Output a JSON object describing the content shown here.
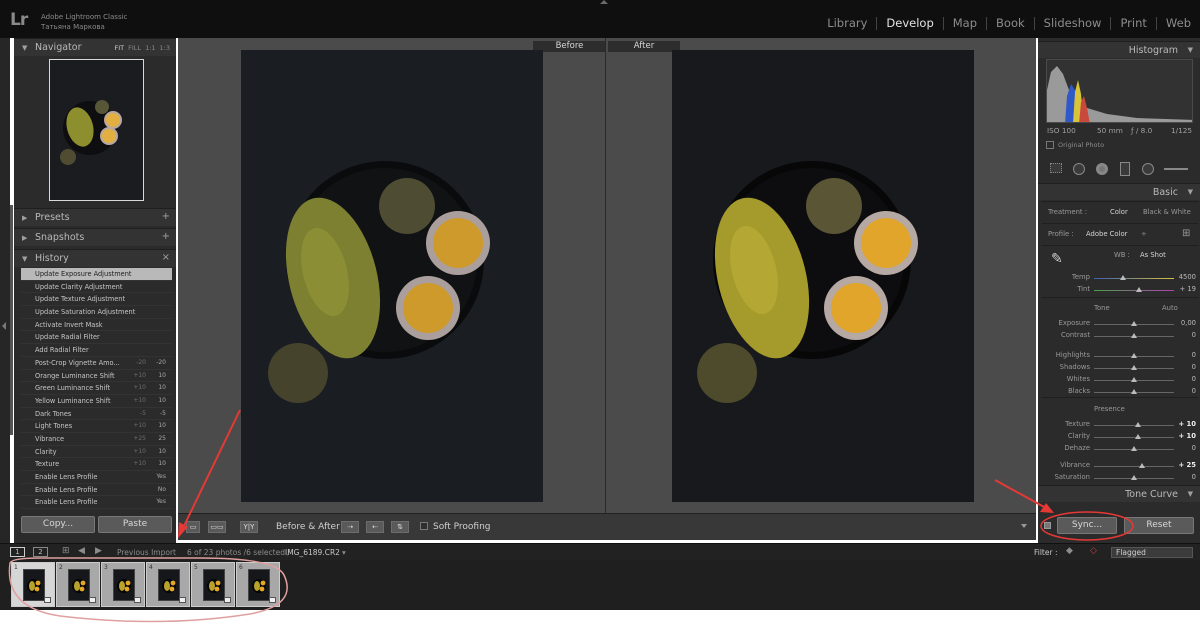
{
  "app": {
    "logo": "Lr",
    "name": "Adobe Lightroom Classic",
    "user": "Татьяна Маркова"
  },
  "modules": [
    {
      "label": "Library",
      "active": false
    },
    {
      "label": "Develop",
      "active": true
    },
    {
      "label": "Map",
      "active": false
    },
    {
      "label": "Book",
      "active": false
    },
    {
      "label": "Slideshow",
      "active": false
    },
    {
      "label": "Print",
      "active": false
    },
    {
      "label": "Web",
      "active": false
    }
  ],
  "left": {
    "navigator": {
      "title": "Navigator",
      "fit": "FIT",
      "fill": "FILL",
      "one": "1:1",
      "three": "1:3"
    },
    "presets": {
      "title": "Presets"
    },
    "snapshots": {
      "title": "Snapshots"
    },
    "history": {
      "title": "History",
      "items": [
        {
          "label": "Update Exposure Adjustment",
          "from": "",
          "to": ""
        },
        {
          "label": "Update Clarity Adjustment",
          "from": "",
          "to": ""
        },
        {
          "label": "Update Texture Adjustment",
          "from": "",
          "to": ""
        },
        {
          "label": "Update Saturation Adjustment",
          "from": "",
          "to": ""
        },
        {
          "label": "Activate Invert Mask",
          "from": "",
          "to": ""
        },
        {
          "label": "Update Radial Filter",
          "from": "",
          "to": ""
        },
        {
          "label": "Add Radial Filter",
          "from": "",
          "to": ""
        },
        {
          "label": "Post-Crop Vignette Amo...",
          "from": "-20",
          "to": "-20"
        },
        {
          "label": "Orange Luminance Shift",
          "from": "+10",
          "to": "10"
        },
        {
          "label": "Green Luminance Shift",
          "from": "+10",
          "to": "10"
        },
        {
          "label": "Yellow Luminance Shift",
          "from": "+10",
          "to": "10"
        },
        {
          "label": "Dark Tones",
          "from": "-5",
          "to": "-5"
        },
        {
          "label": "Light Tones",
          "from": "+10",
          "to": "10"
        },
        {
          "label": "Vibrance",
          "from": "+25",
          "to": "25"
        },
        {
          "label": "Clarity",
          "from": "+10",
          "to": "10"
        },
        {
          "label": "Texture",
          "from": "+10",
          "to": "10"
        },
        {
          "label": "Enable Lens Profile",
          "from": "",
          "to": "Yes"
        },
        {
          "label": "Enable Lens Profile",
          "from": "",
          "to": "No"
        },
        {
          "label": "Enable Lens Profile",
          "from": "",
          "to": "Yes"
        }
      ]
    },
    "copy_label": "Copy...",
    "paste_label": "Paste"
  },
  "center": {
    "before_label": "Before",
    "after_label": "After"
  },
  "toolbar": {
    "view_yy": "Y|Y",
    "before_after_label": "Before & After :",
    "soft_proofing_label": "Soft Proofing"
  },
  "right": {
    "histogram": {
      "title": "Histogram",
      "iso": "ISO 100",
      "focal": "50 mm",
      "aperture": "ƒ / 8.0",
      "shutter": "1/125",
      "original_photo": "Original Photo"
    },
    "basic": {
      "title": "Basic",
      "treatment_label": "Treatment :",
      "treatment_color": "Color",
      "treatment_bw": "Black & White",
      "profile_label": "Profile :",
      "profile_value": "Adobe Color",
      "wb_label": "WB :",
      "wb_value": "As Shot",
      "tone_label": "Tone",
      "auto_label": "Auto",
      "presence_label": "Presence",
      "sliders": [
        {
          "label": "Temp",
          "value": "4500",
          "pos": 0.36,
          "lit": false
        },
        {
          "label": "Tint",
          "value": "+ 19",
          "pos": 0.56,
          "lit": false
        },
        {
          "label": "Exposure",
          "value": "0,00",
          "pos": 0.5,
          "lit": false
        },
        {
          "label": "Contrast",
          "value": "0",
          "pos": 0.5,
          "lit": false
        },
        {
          "label": "Highlights",
          "value": "0",
          "pos": 0.5,
          "lit": false
        },
        {
          "label": "Shadows",
          "value": "0",
          "pos": 0.5,
          "lit": false
        },
        {
          "label": "Whites",
          "value": "0",
          "pos": 0.5,
          "lit": false
        },
        {
          "label": "Blacks",
          "value": "0",
          "pos": 0.5,
          "lit": false
        },
        {
          "label": "Texture",
          "value": "+ 10",
          "pos": 0.55,
          "lit": true
        },
        {
          "label": "Clarity",
          "value": "+ 10",
          "pos": 0.55,
          "lit": true
        },
        {
          "label": "Dehaze",
          "value": "0",
          "pos": 0.5,
          "lit": false
        },
        {
          "label": "Vibrance",
          "value": "+ 25",
          "pos": 0.6,
          "lit": true
        },
        {
          "label": "Saturation",
          "value": "0",
          "pos": 0.5,
          "lit": false
        }
      ]
    },
    "tone_curve": {
      "title": "Tone Curve"
    },
    "sync_label": "Sync...",
    "reset_label": "Reset"
  },
  "filmstrip": {
    "screen1": "1",
    "screen2": "2",
    "source": "Previous Import",
    "count": "6 of 23 photos /6 selected /",
    "filename": "IMG_6189.CR2",
    "filter_label": "Filter :",
    "filter_value": "Flagged",
    "cells": [
      "1",
      "2",
      "3",
      "4",
      "5",
      "6"
    ]
  },
  "colors": {
    "panel": "#2b2b2b",
    "center_bg": "#4b4b4b",
    "annotation_red": "#e53935"
  }
}
